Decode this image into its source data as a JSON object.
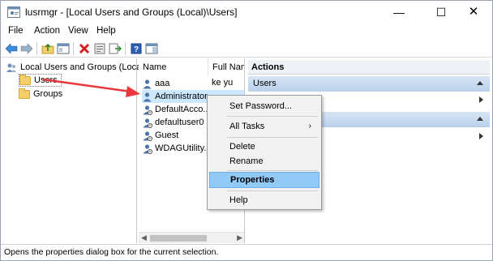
{
  "window": {
    "title": "lusrmgr - [Local Users and Groups (Local)\\Users]",
    "minimize_glyph": "—",
    "maximize_glyph": "☐",
    "close_glyph": "✕"
  },
  "menubar": {
    "items": [
      "File",
      "Action",
      "View",
      "Help"
    ]
  },
  "toolbar": {
    "icons": [
      "back-icon",
      "forward-icon",
      "up-folder-icon",
      "show-hide-tree-icon",
      "delete-icon",
      "properties-icon",
      "export-list-icon",
      "help-icon",
      "show-hide-action-pane-icon"
    ]
  },
  "tree": {
    "root": "Local Users and Groups (Local)",
    "children": [
      {
        "label": "Users",
        "selected": true
      },
      {
        "label": "Groups",
        "selected": false
      }
    ]
  },
  "list": {
    "columns": [
      "Name",
      "Full Nam"
    ],
    "rows": [
      {
        "name": "aaa",
        "full_name": "ke yu",
        "selected": false
      },
      {
        "name": "Administrator",
        "full_name": "",
        "selected": true
      },
      {
        "name": "DefaultAcco...",
        "full_name": "",
        "selected": false
      },
      {
        "name": "defaultuser0",
        "full_name": "",
        "selected": false
      },
      {
        "name": "Guest",
        "full_name": "",
        "selected": false
      },
      {
        "name": "WDAGUtility...",
        "full_name": "",
        "selected": false
      }
    ]
  },
  "actions": {
    "header": "Actions",
    "section_users": "Users",
    "section_second": ""
  },
  "context_menu": {
    "items": [
      "Set Password...",
      "All Tasks",
      "Delete",
      "Rename",
      "Properties",
      "Help"
    ],
    "highlighted": "Properties",
    "submenu_glyph": "›"
  },
  "status": {
    "text": "Opens the properties dialog box for the current selection."
  },
  "colors": {
    "accent_highlight": "#91c9f7",
    "selection": "#cce8ff",
    "annotation_arrow": "#e8383d"
  }
}
